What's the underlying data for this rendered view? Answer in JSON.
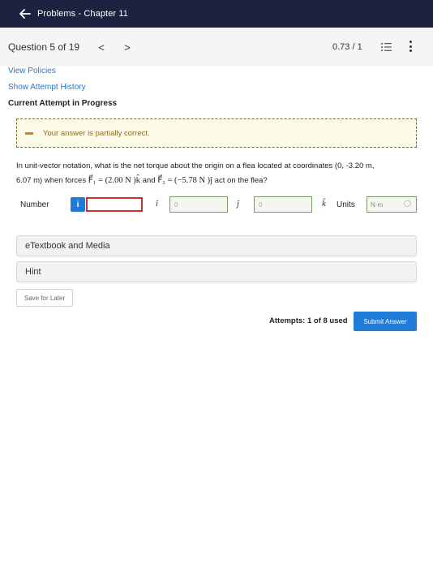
{
  "topbar": {
    "title": "Problems - Chapter 11"
  },
  "question_bar": {
    "question_label": "Question 5 of 19",
    "prev": "<",
    "next": ">",
    "score": "0.73 / 1"
  },
  "links": {
    "view_policies": "View Policies",
    "show_history": "Show Attempt History"
  },
  "current_attempt": "Current Attempt in Progress",
  "feedback": {
    "text": "Your answer is partially correct."
  },
  "question": {
    "line1": "In unit-vector notation, what is the net torque about the origin on a flea located at coordinates (0, -3.20 m,",
    "line2_a": "6.07 m) when forces",
    "f1_expr": "F⃗₁ = (2.00 N )k̂",
    "and": "and",
    "f2_expr": "F⃗₂ = (−5.78 N )ĵ",
    "line2_b": "act on the flea?"
  },
  "answer": {
    "number_label": "Number",
    "info": "i",
    "number_value": "",
    "i_hat": "î",
    "j_value": "0",
    "j_hat": "ĵ",
    "k_value": "0",
    "k_hat": "k̂",
    "units_label": "Units",
    "units_value": "N·m"
  },
  "etextbook": "eTextbook and Media",
  "hint": "Hint",
  "save_later": "Save for Later",
  "attempts": "Attempts: 1 of 8 used",
  "submit": "Submit Answer"
}
